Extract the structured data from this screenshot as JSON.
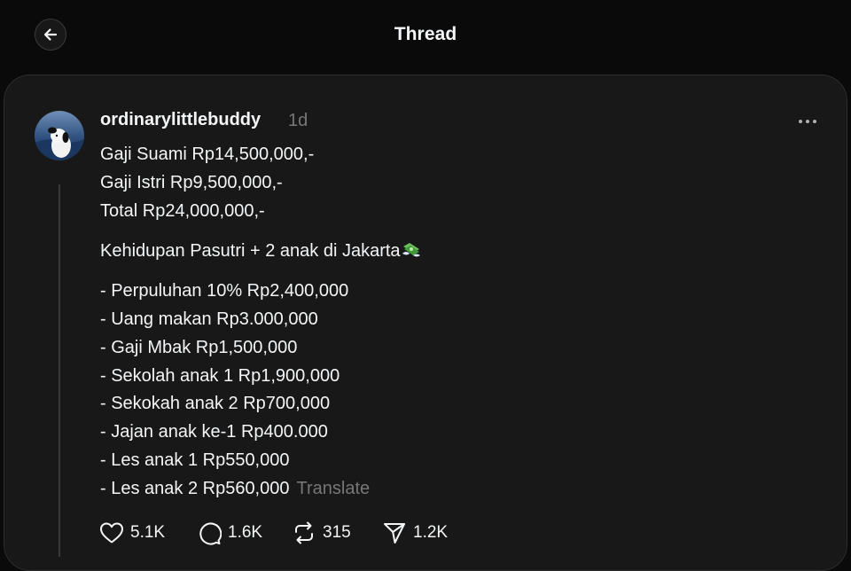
{
  "header": {
    "title": "Thread"
  },
  "post": {
    "username": "ordinarylittlebuddy",
    "time": "1d",
    "lines_a": [
      "Gaji Suami Rp14,500,000,-",
      "Gaji Istri Rp9,500,000,-",
      "Total Rp24,000,000,-"
    ],
    "headline": "Kehidupan Pasutri + 2 anak di Jakarta",
    "headline_emoji": "money-with-wings-icon",
    "items": [
      "- Perpuluhan 10% Rp2,400,000",
      "- Uang makan Rp3.000,000",
      "- Gaji Mbak Rp1,500,000",
      "- Sekolah anak 1 Rp1,900,000",
      "- Sekokah anak 2 Rp700,000",
      "- Jajan anak ke-1 Rp400.000",
      "- Les anak 1 Rp550,000",
      "- Les anak 2 Rp560,000"
    ],
    "translate_label": "Translate"
  },
  "actions": {
    "likes": "5.1K",
    "replies": "1.6K",
    "reposts": "315",
    "shares": "1.2K"
  },
  "icons": {
    "back": "arrow-left-icon",
    "more": "more-horizontal-icon",
    "like": "heart-icon",
    "reply": "comment-icon",
    "repost": "repost-icon",
    "share": "send-icon"
  }
}
